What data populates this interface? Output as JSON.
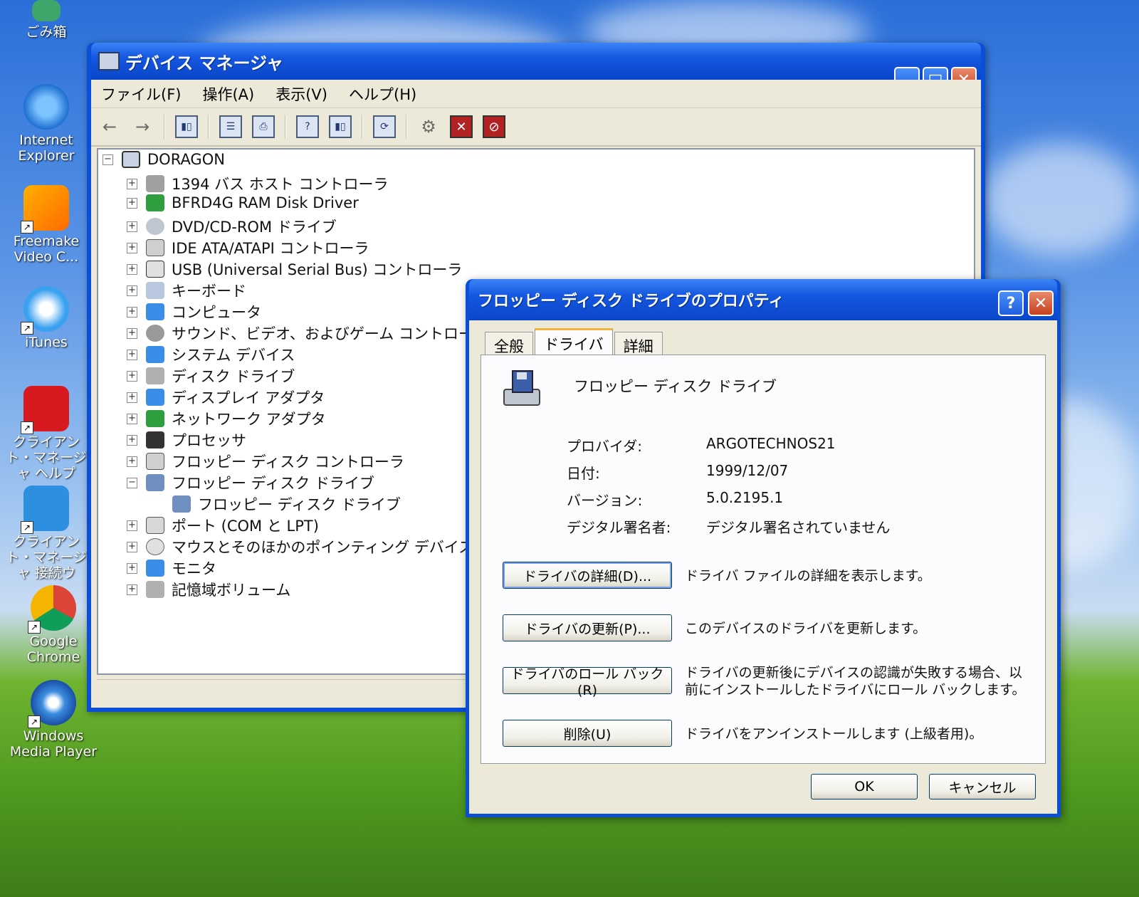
{
  "desktop": {
    "icons": [
      {
        "label": "ごみ箱"
      },
      {
        "label": "Internet Explorer"
      },
      {
        "label": "Freemake Video C..."
      },
      {
        "label": "iTunes"
      },
      {
        "label": "クライアント・マネージャ ヘルプ"
      },
      {
        "label": "クライアント・マネージャ 接続ウ"
      },
      {
        "label": "Google Chrome"
      },
      {
        "label": "Windows Media Player"
      }
    ]
  },
  "device_manager": {
    "title": "デバイス マネージャ",
    "menu": [
      "ファイル(F)",
      "操作(A)",
      "表示(V)",
      "ヘルプ(H)"
    ],
    "root": "DORAGON",
    "tree": [
      {
        "label": "1394 バス ホスト コントローラ",
        "expander": "+"
      },
      {
        "label": "BFRD4G RAM Disk Driver",
        "expander": "+"
      },
      {
        "label": "DVD/CD-ROM ドライブ",
        "expander": "+"
      },
      {
        "label": "IDE ATA/ATAPI コントローラ",
        "expander": "+"
      },
      {
        "label": "USB (Universal Serial Bus) コントローラ",
        "expander": "+"
      },
      {
        "label": "キーボード",
        "expander": "+"
      },
      {
        "label": "コンピュータ",
        "expander": "+"
      },
      {
        "label": "サウンド、ビデオ、およびゲーム コントローラ",
        "expander": "+"
      },
      {
        "label": "システム デバイス",
        "expander": "+"
      },
      {
        "label": "ディスク ドライブ",
        "expander": "+"
      },
      {
        "label": "ディスプレイ アダプタ",
        "expander": "+"
      },
      {
        "label": "ネットワーク アダプタ",
        "expander": "+"
      },
      {
        "label": "プロセッサ",
        "expander": "+"
      },
      {
        "label": "フロッピー ディスク コントローラ",
        "expander": "+"
      },
      {
        "label": "フロッピー ディスク ドライブ",
        "expander": "−"
      },
      {
        "label": "フロッピー ディスク ドライブ",
        "expander": ""
      },
      {
        "label": "ポート (COM と LPT)",
        "expander": "+"
      },
      {
        "label": "マウスとそのほかのポインティング デバイス",
        "expander": "+"
      },
      {
        "label": "モニタ",
        "expander": "+"
      },
      {
        "label": "記憶域ボリューム",
        "expander": "+"
      }
    ]
  },
  "dialog": {
    "title": "フロッピー ディスク ドライブのプロパティ",
    "tabs": [
      "全般",
      "ドライバ",
      "詳細"
    ],
    "device_name": "フロッピー ディスク ドライブ",
    "properties": {
      "provider_label": "プロバイダ:",
      "provider_value": "ARGOTECHNOS21",
      "date_label": "日付:",
      "date_value": "1999/12/07",
      "version_label": "バージョン:",
      "version_value": "5.0.2195.1",
      "signer_label": "デジタル署名者:",
      "signer_value": "デジタル署名されていません"
    },
    "actions": [
      {
        "button": "ドライバの詳細(D)...",
        "desc": "ドライバ ファイルの詳細を表示します。"
      },
      {
        "button": "ドライバの更新(P)...",
        "desc": "このデバイスのドライバを更新します。"
      },
      {
        "button": "ドライバのロール バック(R)",
        "desc": "ドライバの更新後にデバイスの認識が失敗する場合、以前にインストールしたドライバにロール バックします。"
      },
      {
        "button": "削除(U)",
        "desc": "ドライバをアンインストールします (上級者用)。"
      }
    ],
    "ok": "OK",
    "cancel": "キャンセル"
  }
}
